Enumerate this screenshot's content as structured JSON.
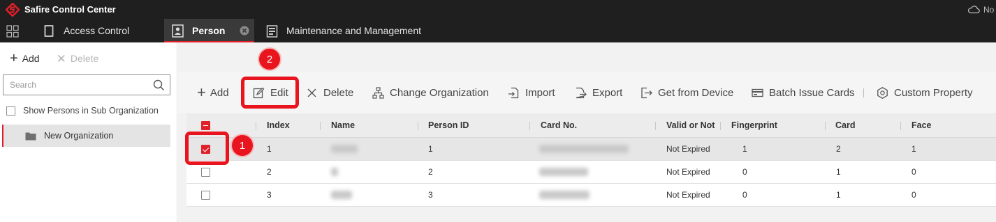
{
  "app": {
    "title": "Safire Control Center",
    "top_right_text": "No"
  },
  "colors": {
    "accent": "#e0202a",
    "annotation": "#e8141e",
    "titlebar": "#1f1f1f"
  },
  "tabs": [
    {
      "label": "Access Control",
      "icon": "door-icon"
    },
    {
      "label": "Person",
      "icon": "person-card-icon",
      "active": true
    },
    {
      "label": "Maintenance and Management",
      "icon": "maintenance-icon"
    }
  ],
  "left_panel": {
    "add_label": "Add",
    "delete_label": "Delete",
    "search_placeholder": "Search",
    "show_sub_label": "Show Persons in Sub Organization",
    "org_name": "New Organization"
  },
  "toolbar": {
    "add": "Add",
    "edit": "Edit",
    "delete": "Delete",
    "change_org": "Change Organization",
    "import": "Import",
    "export": "Export",
    "get_from_device": "Get from Device",
    "batch_issue_cards": "Batch Issue Cards",
    "custom_property": "Custom Property"
  },
  "table": {
    "columns": [
      "Index",
      "Name",
      "Person ID",
      "Card No.",
      "Valid or Not",
      "Fingerprint",
      "Card",
      "Face"
    ],
    "rows": [
      {
        "checked": true,
        "index": "1",
        "person_id": "1",
        "valid": "Not Expired",
        "fingerprint": "1",
        "card": "2",
        "face": "1"
      },
      {
        "checked": false,
        "index": "2",
        "person_id": "2",
        "valid": "Not Expired",
        "fingerprint": "0",
        "card": "1",
        "face": "0"
      },
      {
        "checked": false,
        "index": "3",
        "person_id": "3",
        "valid": "Not Expired",
        "fingerprint": "0",
        "card": "1",
        "face": "0"
      }
    ]
  },
  "annotations": {
    "step1": "1",
    "step2": "2"
  }
}
